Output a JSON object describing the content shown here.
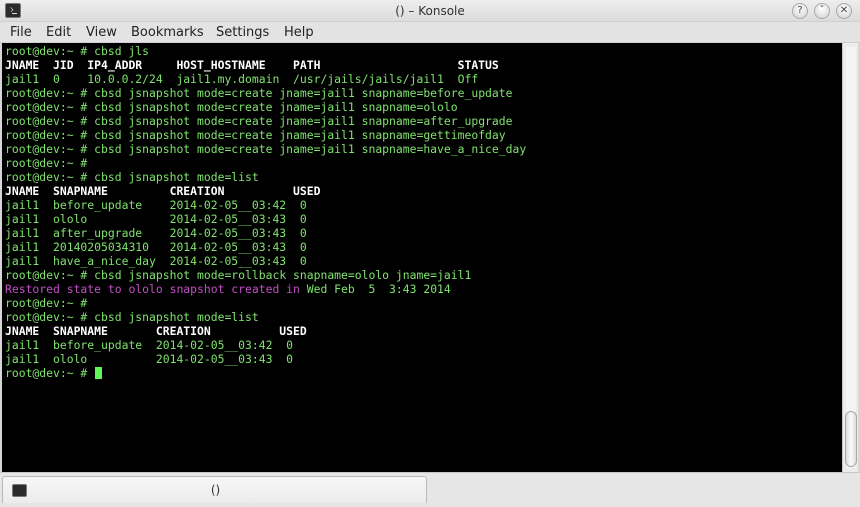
{
  "window": {
    "title": "() – Konsole",
    "buttons": {
      "help": "?",
      "minimize": "ˇ",
      "maximize": "ˆ",
      "close": "✕"
    }
  },
  "menu": [
    "File",
    "Edit",
    "View",
    "Bookmarks",
    "Settings",
    "Help"
  ],
  "terminal": {
    "lines": [
      {
        "type": "prompt",
        "prompt": "root@dev:~ # ",
        "cmd": "cbsd jls"
      },
      {
        "type": "header",
        "text": "JNAME  JID  IP4_ADDR     HOST_HOSTNAME    PATH                    STATUS"
      },
      {
        "type": "output",
        "text": "jail1  0    10.0.0.2/24  jail1.my.domain  /usr/jails/jails/jail1  Off"
      },
      {
        "type": "prompt",
        "prompt": "root@dev:~ # ",
        "cmd": "cbsd jsnapshot mode=create jname=jail1 snapname=before_update"
      },
      {
        "type": "prompt",
        "prompt": "root@dev:~ # ",
        "cmd": "cbsd jsnapshot mode=create jname=jail1 snapname=ololo"
      },
      {
        "type": "prompt",
        "prompt": "root@dev:~ # ",
        "cmd": "cbsd jsnapshot mode=create jname=jail1 snapname=after_upgrade"
      },
      {
        "type": "prompt",
        "prompt": "root@dev:~ # ",
        "cmd": "cbsd jsnapshot mode=create jname=jail1 snapname=gettimeofday"
      },
      {
        "type": "prompt",
        "prompt": "root@dev:~ # ",
        "cmd": "cbsd jsnapshot mode=create jname=jail1 snapname=have_a_nice_day"
      },
      {
        "type": "prompt",
        "prompt": "root@dev:~ # ",
        "cmd": ""
      },
      {
        "type": "prompt",
        "prompt": "root@dev:~ # ",
        "cmd": "cbsd jsnapshot mode=list"
      },
      {
        "type": "header",
        "text": "JNAME  SNAPNAME         CREATION          USED"
      },
      {
        "type": "output",
        "text": "jail1  before_update    2014-02-05__03:42  0"
      },
      {
        "type": "output",
        "text": "jail1  ololo            2014-02-05__03:43  0"
      },
      {
        "type": "output",
        "text": "jail1  after_upgrade    2014-02-05__03:43  0"
      },
      {
        "type": "output",
        "text": "jail1  20140205034310   2014-02-05__03:43  0"
      },
      {
        "type": "output",
        "text": "jail1  have_a_nice_day  2014-02-05__03:43  0"
      },
      {
        "type": "prompt",
        "prompt": "root@dev:~ # ",
        "cmd": "cbsd jsnapshot mode=rollback snapname=ololo jname=jail1"
      },
      {
        "type": "status",
        "text": "Restored state to ololo snapshot created in ",
        "date": "Wed Feb  5  3:43 2014"
      },
      {
        "type": "prompt",
        "prompt": "root@dev:~ # ",
        "cmd": ""
      },
      {
        "type": "prompt",
        "prompt": "root@dev:~ # ",
        "cmd": "cbsd jsnapshot mode=list"
      },
      {
        "type": "header",
        "text": "JNAME  SNAPNAME       CREATION          USED"
      },
      {
        "type": "output",
        "text": "jail1  before_update  2014-02-05__03:42  0"
      },
      {
        "type": "output",
        "text": "jail1  ololo          2014-02-05__03:43  0"
      },
      {
        "type": "cursor",
        "prompt": "root@dev:~ # "
      }
    ]
  },
  "tab": {
    "label": "()"
  },
  "colors": {
    "terminal_bg": "#000000",
    "text_green": "#7fe36d",
    "header_white": "#ffffff",
    "status_magenta": "#c24ec6",
    "cursor": "#5ff557"
  }
}
